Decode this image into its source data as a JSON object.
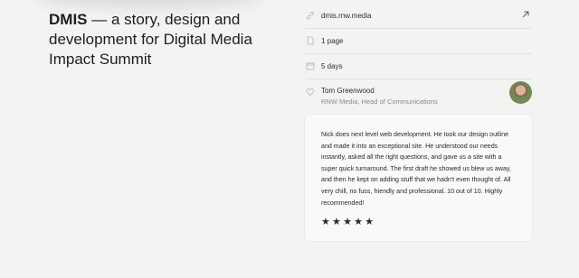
{
  "heading": {
    "bold": "DMIS",
    "rest": " — a story, design and development for Digital Media Impact Summit"
  },
  "meta": {
    "link": "dmis.rnw.media",
    "pages": "1 page",
    "duration": "5 days"
  },
  "testimonial": {
    "name": "Tom Greenwood",
    "role": "RNW Media, Head of Communications",
    "quote": "Nick does next level web development. He took our design outline and made it into an exceptional site. He understood our needs instantly, asked all the right questions, and gave us a site with a super quick turnaround. The first draft he showed us blew us away, and then he kept on adding stuff that we hadn't even thought of. All very chill, no fuss, friendly and professional. 10 out of 10. Highly recommended!",
    "stars": "★★★★★",
    "rating": 5
  },
  "icons": {
    "link": "link-icon",
    "page": "page-icon",
    "calendar": "calendar-icon",
    "heart": "heart-icon",
    "external": "external-arrow-icon"
  }
}
